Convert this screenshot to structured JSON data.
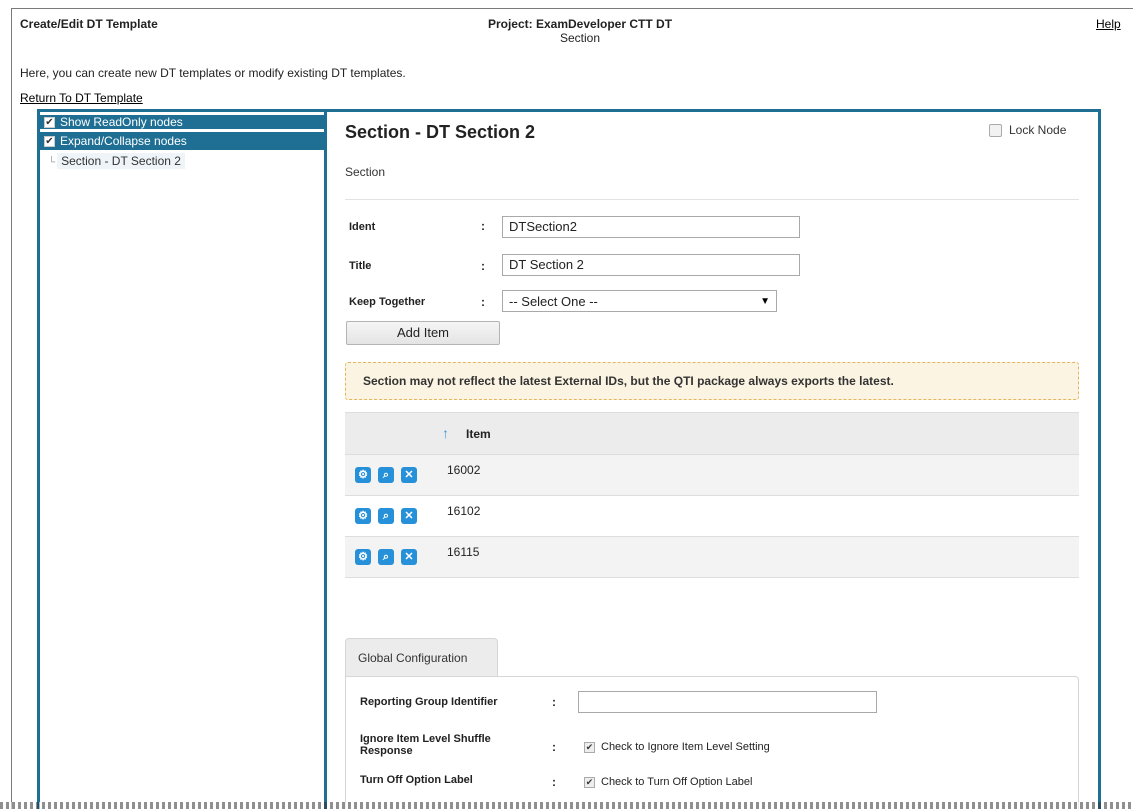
{
  "header": {
    "title": "Create/Edit DT Template",
    "project": "Project: ExamDeveloper CTT DT",
    "subtitle": "Section",
    "help": "Help"
  },
  "intro": "Here, you can create new DT templates or modify existing DT templates.",
  "return_link": "Return To DT Template",
  "tree": {
    "show_readonly": "Show ReadOnly nodes",
    "expand_collapse": "Expand/Collapse nodes",
    "node": "Section - DT Section 2"
  },
  "section": {
    "title": "Section - DT Section 2",
    "lock_label": "Lock Node",
    "subtitle": "Section",
    "ident_label": "Ident",
    "ident_value": "DTSection2",
    "title_label": "Title",
    "title_value": "DT Section 2",
    "keep_label": "Keep Together",
    "keep_value": "-- Select One --",
    "colon": ":",
    "add_item": "Add Item"
  },
  "warning": "Section may not reflect the latest External IDs, but the QTI package always exports the latest.",
  "table": {
    "sort_icon": "↑",
    "col_item": "Item",
    "rows": [
      {
        "item": "16002"
      },
      {
        "item": "16102"
      },
      {
        "item": "16115"
      }
    ]
  },
  "global": {
    "tab": "Global Configuration",
    "reporting_label": "Reporting Group Identifier",
    "shuffle_label_1": "Ignore Item Level Shuffle",
    "shuffle_label_2": "Response",
    "shuffle_check": "Check to Ignore Item Level Setting",
    "option_label": "Turn Off Option Label",
    "option_check": "Check to Turn Off Option Label",
    "colon": ":"
  },
  "colors": {
    "frame": "#1f6f94",
    "icon": "#2690d8",
    "warning_bg": "#fcf4e2"
  }
}
